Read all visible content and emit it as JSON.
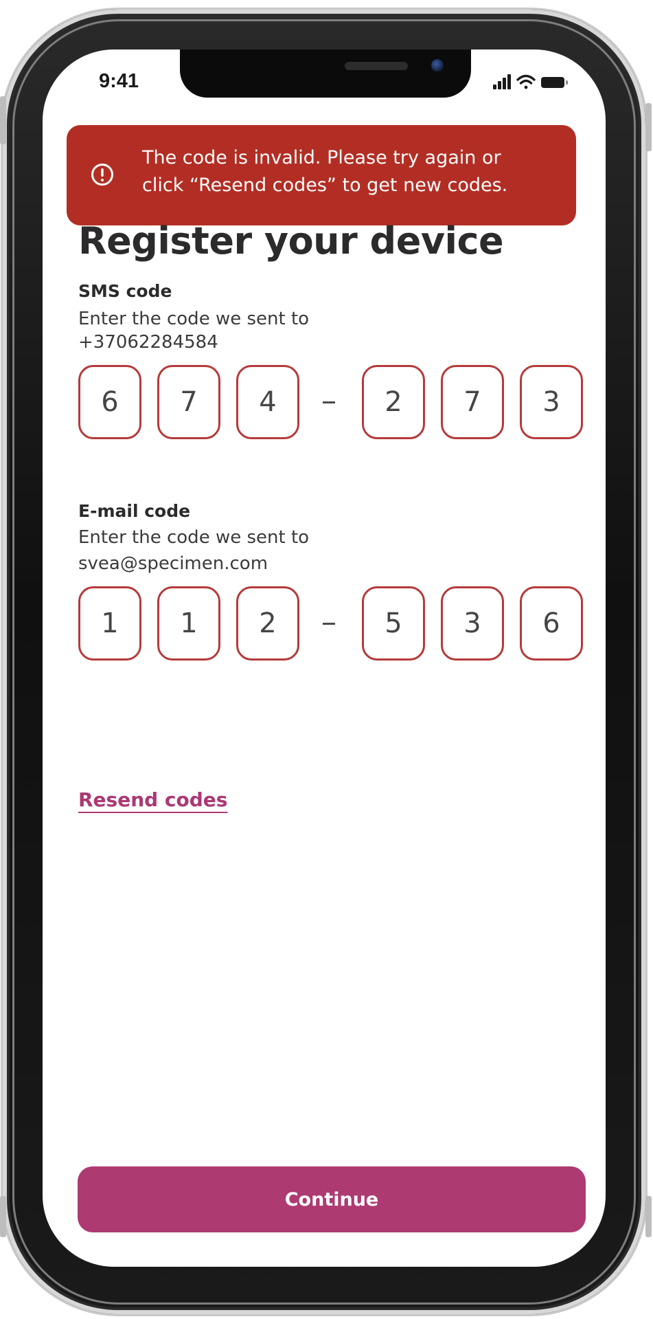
{
  "status_bar": {
    "time": "9:41",
    "icons": [
      "signal-icon",
      "wifi-icon",
      "battery-icon"
    ]
  },
  "error_banner": {
    "icon": "alert-circle-icon",
    "line1": "The code is invalid. Please try again or",
    "line2": "click “Resend codes” to get new codes.",
    "background_color": "#b22e24"
  },
  "title": "Register your device",
  "sms": {
    "label": "SMS code",
    "description": "Enter the code we sent to",
    "destination": "+37062284584",
    "digits": [
      "6",
      "7",
      "4",
      "2",
      "7",
      "3"
    ]
  },
  "email": {
    "label": "E-mail code",
    "description": "Enter the code we sent to",
    "destination": "svea@specimen.com",
    "digits": [
      "1",
      "1",
      "2",
      "5",
      "3",
      "6"
    ]
  },
  "resend_label": "Resend codes",
  "continue_label": "Continue",
  "colors": {
    "accent": "#ae3a72",
    "error_border": "#b53a3a"
  }
}
